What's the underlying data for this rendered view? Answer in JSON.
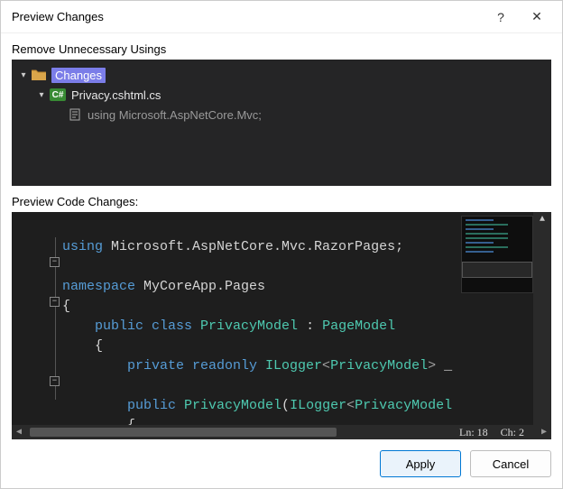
{
  "dialog": {
    "title": "Preview Changes",
    "help_tooltip": "?",
    "close_tooltip": "✕"
  },
  "tree": {
    "heading": "Remove Unnecessary Usings",
    "root_label": "Changes",
    "file_label": "Privacy.cshtml.cs",
    "file_badge": "C#",
    "removed_line": "using Microsoft.AspNetCore.Mvc;"
  },
  "preview": {
    "heading": "Preview Code Changes:",
    "lines": {
      "l1a": "using",
      "l1b": " Microsoft.AspNetCore.Mvc.RazorPages;",
      "l2a": "namespace",
      "l2b": " MyCoreApp.Pages",
      "l3": "{",
      "l4a": "public",
      "l4b": " class",
      "l4c": " PrivacyModel",
      "l4d": " : ",
      "l4e": "PageModel",
      "l5": "{",
      "l6a": "private",
      "l6b": " readonly",
      "l6c": " ILogger",
      "l6d": "<",
      "l6e": "PrivacyModel",
      "l6f": ">",
      "l6g": " _",
      "l7a": "public",
      "l7b": " PrivacyModel",
      "l7c": "(",
      "l7d": "ILogger",
      "l7e": "<",
      "l7f": "PrivacyModel",
      "l8": "{"
    },
    "status_line": "Ln: 18",
    "status_col": "Ch: 2"
  },
  "buttons": {
    "apply": "Apply",
    "cancel": "Cancel"
  }
}
